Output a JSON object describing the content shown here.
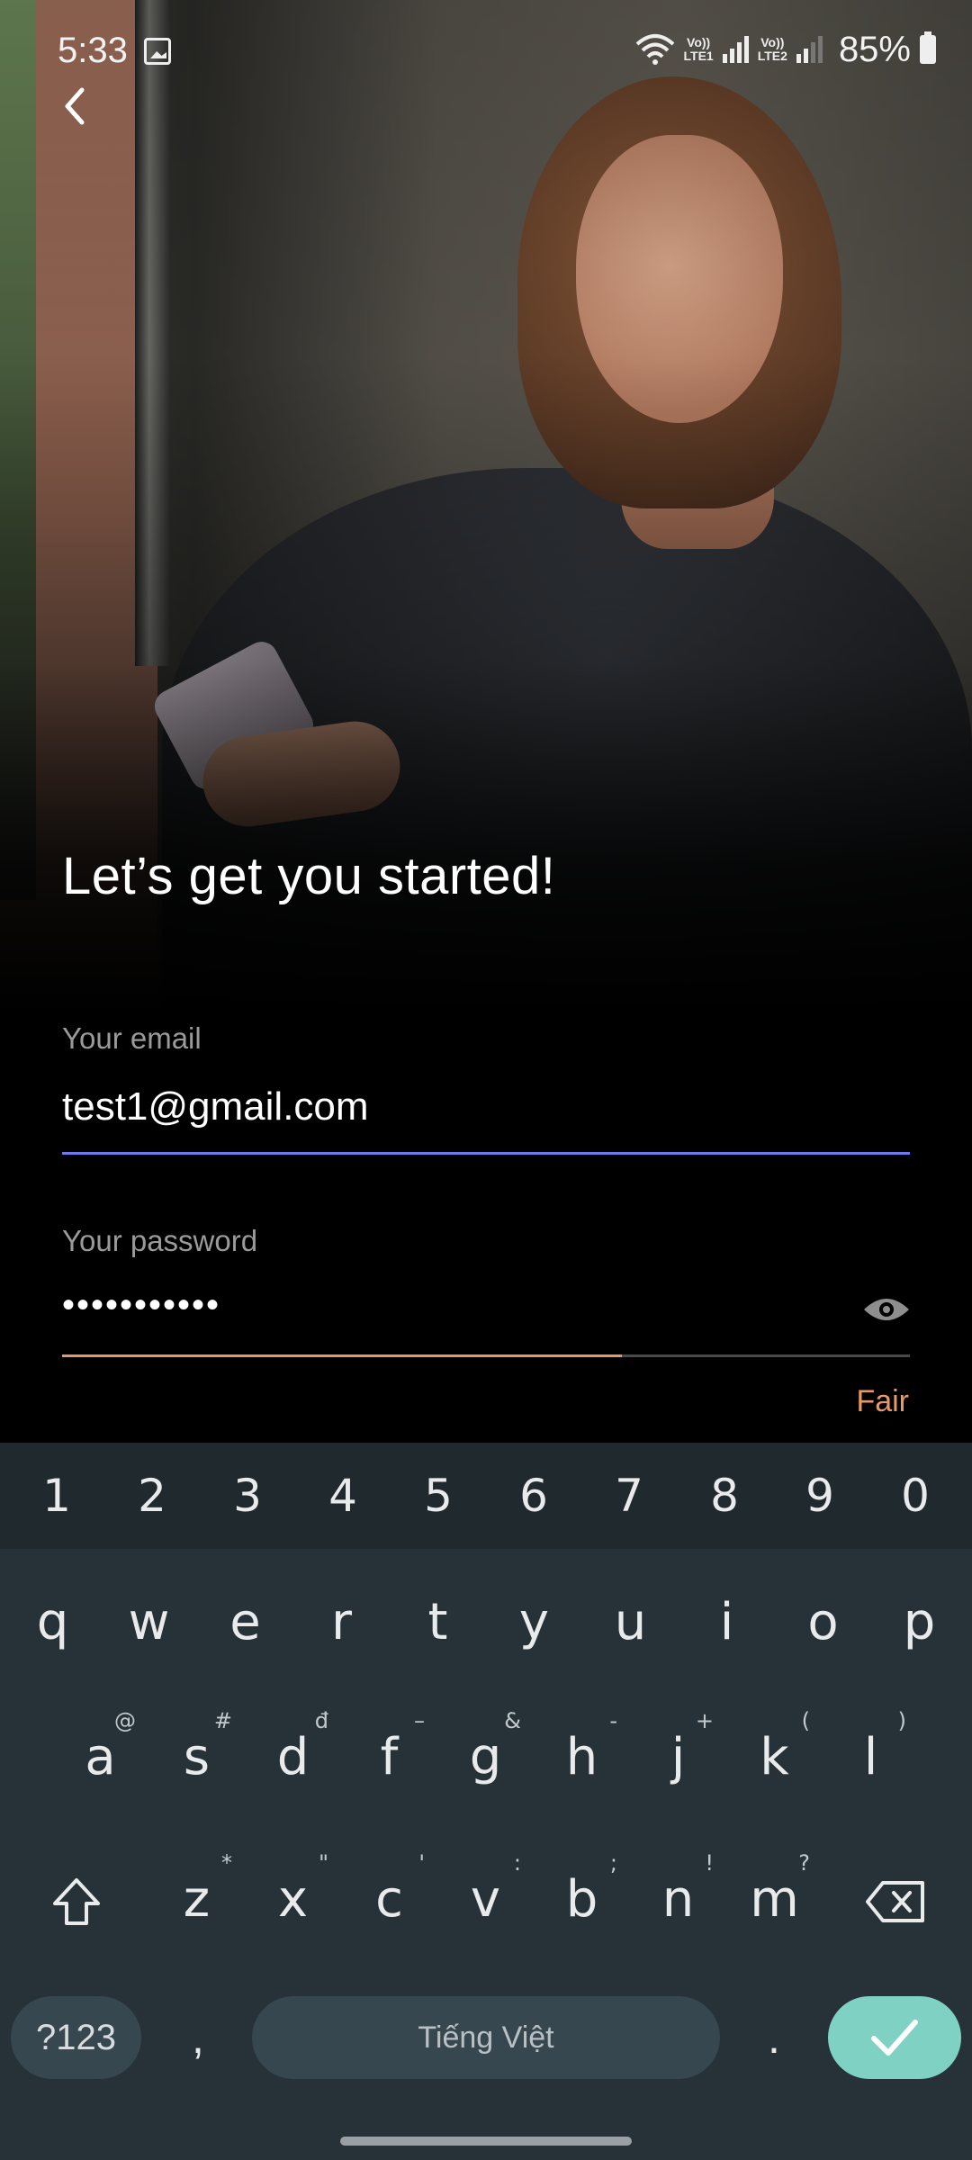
{
  "status_bar": {
    "time": "5:33",
    "lte1": [
      "Vo))",
      "LTE1"
    ],
    "lte2": [
      "Vo))",
      "LTE2"
    ],
    "battery": "85%"
  },
  "page": {
    "headline": "Let’s get you started!"
  },
  "form": {
    "email_label": "Your email",
    "email_value": "test1@gmail.com",
    "password_label": "Your password",
    "password_value": "•••••••••••",
    "password_strength": "Fair",
    "password_strength_level": 0.66,
    "colors": {
      "email_underline": "#6f78f0",
      "strength": "#e39a68"
    }
  },
  "keyboard": {
    "number_row": [
      "1",
      "2",
      "3",
      "4",
      "5",
      "6",
      "7",
      "8",
      "9",
      "0"
    ],
    "row1": [
      {
        "key": "q"
      },
      {
        "key": "w"
      },
      {
        "key": "e"
      },
      {
        "key": "r"
      },
      {
        "key": "t"
      },
      {
        "key": "y"
      },
      {
        "key": "u"
      },
      {
        "key": "i"
      },
      {
        "key": "o"
      },
      {
        "key": "p"
      }
    ],
    "row2": [
      {
        "key": "a",
        "hint": "@"
      },
      {
        "key": "s",
        "hint": "#"
      },
      {
        "key": "d",
        "hint": "đ"
      },
      {
        "key": "f",
        "hint": "–"
      },
      {
        "key": "g",
        "hint": "&"
      },
      {
        "key": "h",
        "hint": "-"
      },
      {
        "key": "j",
        "hint": "+"
      },
      {
        "key": "k",
        "hint": "("
      },
      {
        "key": "l",
        "hint": ")"
      }
    ],
    "row3": [
      {
        "key": "z",
        "hint": "*"
      },
      {
        "key": "x",
        "hint": "\""
      },
      {
        "key": "c",
        "hint": "'"
      },
      {
        "key": "v",
        "hint": ":"
      },
      {
        "key": "b",
        "hint": ";"
      },
      {
        "key": "n",
        "hint": "!"
      },
      {
        "key": "m",
        "hint": "?"
      }
    ],
    "symbols_label": "?123",
    "comma": ",",
    "space_label": "Tiếng Việt",
    "period": ".",
    "colors": {
      "background": "#263238",
      "enter": "#7fd1c4"
    }
  }
}
